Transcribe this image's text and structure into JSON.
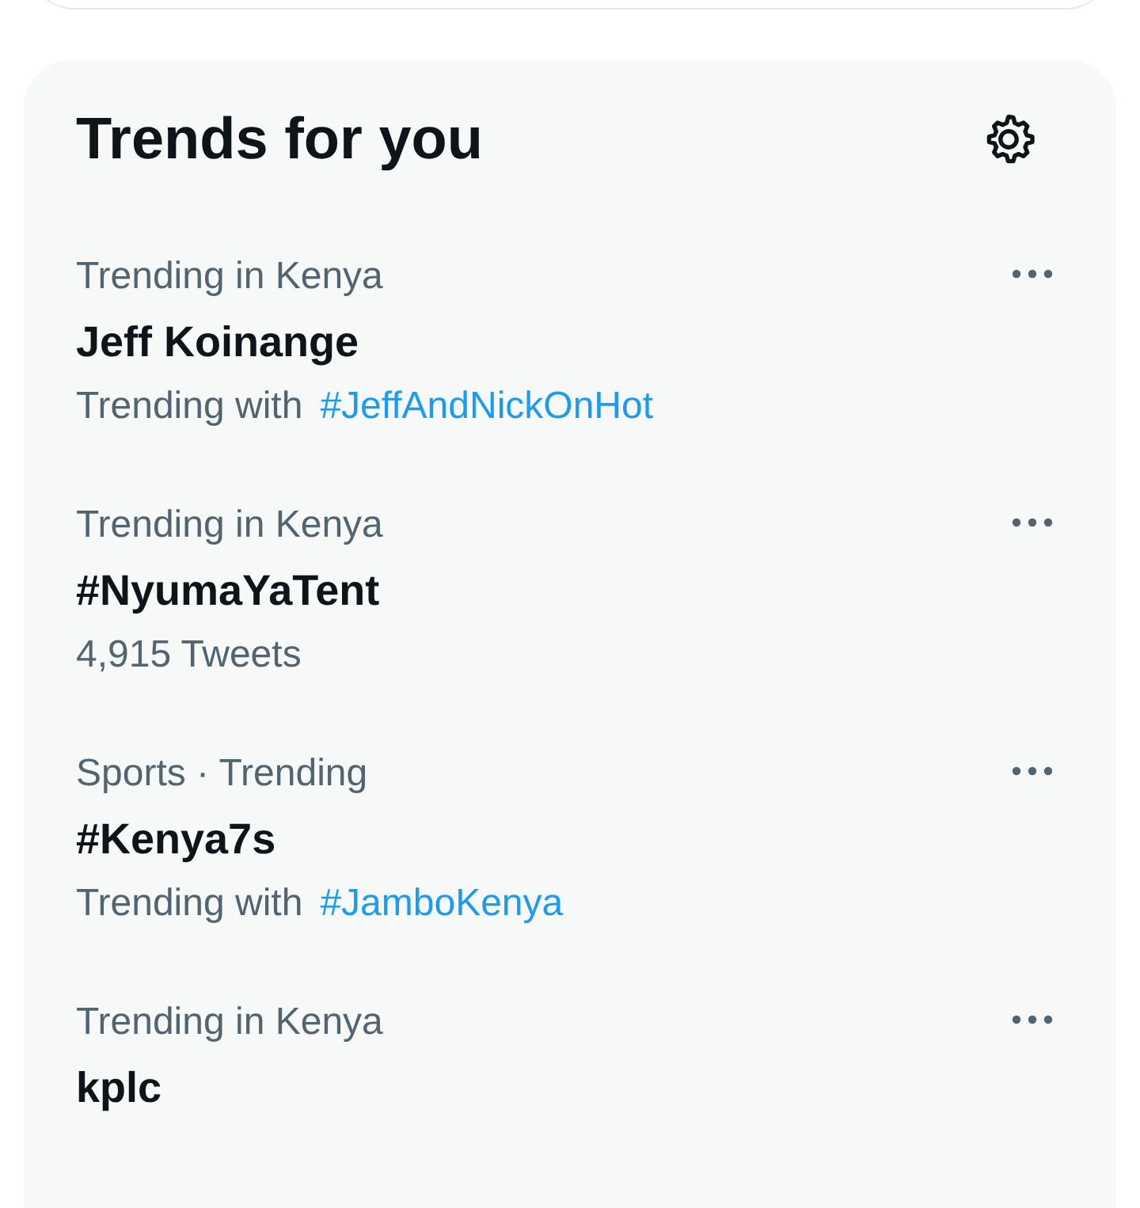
{
  "title": "Trends for you",
  "trends": [
    {
      "category": "Trending in Kenya",
      "name": "Jeff Koinange",
      "kind": "hashtag",
      "meta": "Trending with",
      "hashtag": "#JeffAndNickOnHot"
    },
    {
      "category": "Trending in Kenya",
      "name": "#NyumaYaTent",
      "kind": "count",
      "meta": "4,915 Tweets"
    },
    {
      "category": "Sports · Trending",
      "name": "#Kenya7s",
      "kind": "hashtag",
      "meta": "Trending with",
      "hashtag": "#JamboKenya"
    },
    {
      "category": "Trending in Kenya",
      "name": "kplc",
      "kind": "none"
    }
  ]
}
